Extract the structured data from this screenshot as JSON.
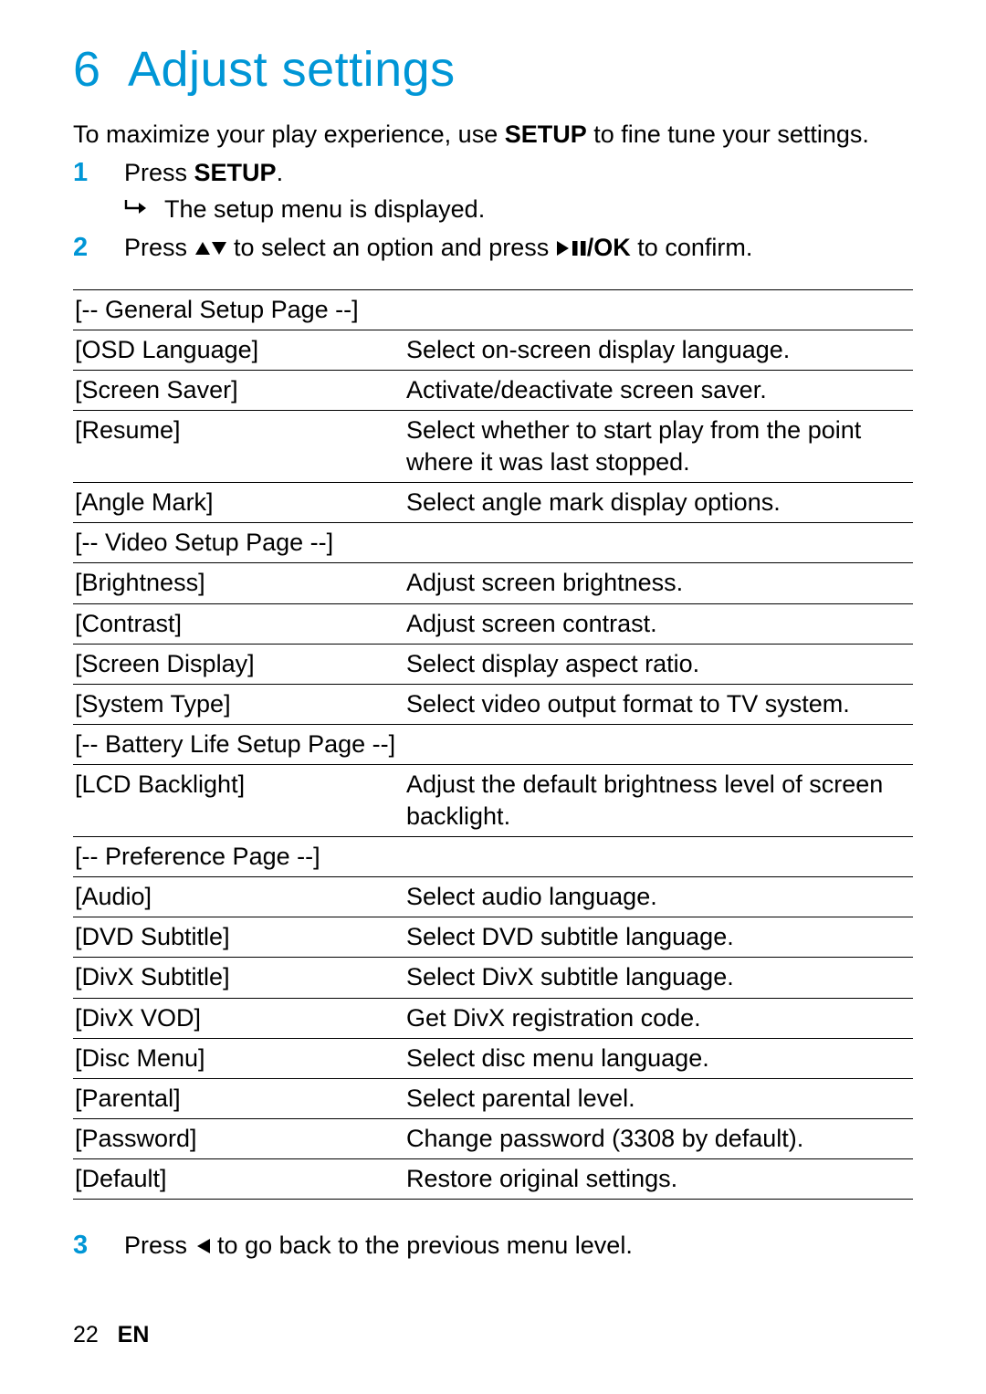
{
  "heading": {
    "num": "6",
    "title": "Adjust settings"
  },
  "intro_a": "To maximize your play experience, use ",
  "intro_b": "SETUP",
  "intro_c": " to fine tune your settings.",
  "steps": {
    "s1": {
      "num": "1",
      "a": "Press ",
      "b": "SETUP",
      "c": ".",
      "sub": "The setup menu is displayed."
    },
    "s2": {
      "num": "2",
      "a": "Press ",
      "b": " to select an option and press ",
      "c": "/OK",
      "d": " to confirm."
    },
    "s3": {
      "num": "3",
      "a": "Press ",
      "b": " to go back to the previous menu level."
    }
  },
  "rows": [
    {
      "l": "[-- General Setup Page --]",
      "r": ""
    },
    {
      "l": "[OSD Language]",
      "r": "Select on-screen display language."
    },
    {
      "l": "[Screen Saver]",
      "r": "Activate/deactivate screen saver."
    },
    {
      "l": "[Resume]",
      "r": "Select whether to start play from the point where it was last stopped."
    },
    {
      "l": "[Angle Mark]",
      "r": "Select angle mark display options."
    },
    {
      "l": "[-- Video Setup Page --]",
      "r": ""
    },
    {
      "l": "[Brightness]",
      "r": "Adjust screen brightness."
    },
    {
      "l": "[Contrast]",
      "r": "Adjust screen contrast."
    },
    {
      "l": "[Screen Display]",
      "r": "Select display aspect ratio."
    },
    {
      "l": "[System Type]",
      "r": "Select video output format to TV system."
    },
    {
      "l": "[-- Battery Life Setup Page --]",
      "r": ""
    },
    {
      "l": "[LCD Backlight]",
      "r": "Adjust the default brightness level of screen backlight."
    },
    {
      "l": "[-- Preference Page --]",
      "r": ""
    },
    {
      "l": "[Audio]",
      "r": "Select audio language."
    },
    {
      "l": "[DVD Subtitle]",
      "r": "Select DVD subtitle language."
    },
    {
      "l": "[DivX Subtitle]",
      "r": "Select DivX subtitle language."
    },
    {
      "l": "[DivX VOD]",
      "r": "Get DivX registration code."
    },
    {
      "l": "[Disc Menu]",
      "r": "Select disc menu language."
    },
    {
      "l": "[Parental]",
      "r": "Select parental level."
    },
    {
      "l": "[Password]",
      "r": "Change password (3308 by default)."
    },
    {
      "l": "[Default]",
      "r": "Restore original settings."
    }
  ],
  "footer": {
    "page": "22",
    "lang": "EN"
  }
}
